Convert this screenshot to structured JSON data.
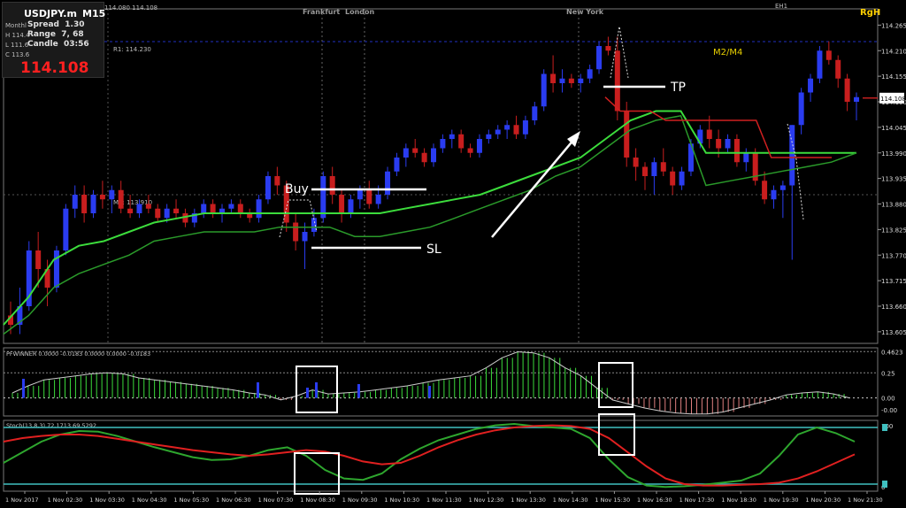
{
  "header": {
    "symbol": "USDJPY.m",
    "timeframe": "M15",
    "top_prices": "114.080 114.108",
    "top_right_mark": "EH1",
    "right_tag": "RgH",
    "info": [
      {
        "side": "Monthl",
        "label": "Spread",
        "value": "1.30"
      },
      {
        "side": "H 114.4",
        "label": "Range",
        "value": "7, 68"
      },
      {
        "side": "L 111.6",
        "label": "Candle",
        "value": "03:56"
      },
      {
        "side": "C 113.6",
        "label": "",
        "value": ""
      }
    ],
    "current_price": "114.108"
  },
  "colors": {
    "bull": "#2a3cf0",
    "bear": "#c81e1e",
    "green": "#3cdc3c",
    "dark_green": "#2a9a2a",
    "red_line": "#d02020",
    "cyan": "#40c0c0"
  },
  "chart_data": [
    {
      "type": "candlestick",
      "title": "USDJPY.m M15",
      "ylim": [
        113.58,
        114.3
      ],
      "y_ticks": [
        "114.265",
        "114.210",
        "114.155",
        "114.100",
        "114.045",
        "113.990",
        "113.935",
        "113.880",
        "113.825",
        "113.770",
        "113.715",
        "113.660",
        "113.605"
      ],
      "y_tick_values": [
        114.265,
        114.21,
        114.155,
        114.1,
        114.045,
        113.99,
        113.935,
        113.88,
        113.825,
        113.77,
        113.715,
        113.66,
        113.605
      ],
      "current_price_label": "114.108",
      "session_labels": [
        "Frankfurt",
        "London",
        "New York"
      ],
      "pivot_labels": [
        "R1: 114.230",
        "M3: 113.910",
        "M2/M4"
      ],
      "annotations": [
        "Buy",
        "SL",
        "TP"
      ],
      "x_labels": [
        "1 Nov 2017",
        "1 Nov 02:30",
        "1 Nov 03:30",
        "1 Nov 04:30",
        "1 Nov 05:30",
        "1 Nov 06:30",
        "1 Nov 07:30",
        "1 Nov 08:30",
        "1 Nov 09:30",
        "1 Nov 10:30",
        "1 Nov 11:30",
        "1 Nov 12:30",
        "1 Nov 13:30",
        "1 Nov 14:30",
        "1 Nov 15:30",
        "1 Nov 16:30",
        "1 Nov 17:30",
        "1 Nov 18:30",
        "1 Nov 19:30",
        "1 Nov 20:30",
        "1 Nov 21:30"
      ],
      "series": [
        {
          "name": "ohlc",
          "values": [
            [
              113.64,
              113.67,
              113.6,
              113.62
            ],
            [
              113.62,
              113.7,
              113.6,
              113.66
            ],
            [
              113.66,
              113.8,
              113.65,
              113.78
            ],
            [
              113.78,
              113.82,
              113.7,
              113.74
            ],
            [
              113.74,
              113.76,
              113.66,
              113.7
            ],
            [
              113.7,
              113.79,
              113.69,
              113.78
            ],
            [
              113.78,
              113.88,
              113.77,
              113.87
            ],
            [
              113.87,
              113.92,
              113.85,
              113.9
            ],
            [
              113.9,
              113.92,
              113.84,
              113.86
            ],
            [
              113.86,
              113.91,
              113.85,
              113.9
            ],
            [
              113.9,
              113.93,
              113.87,
              113.89
            ],
            [
              113.89,
              113.92,
              113.86,
              113.91
            ],
            [
              113.91,
              113.93,
              113.86,
              113.87
            ],
            [
              113.87,
              113.9,
              113.85,
              113.86
            ],
            [
              113.86,
              113.89,
              113.85,
              113.88
            ],
            [
              113.88,
              113.9,
              113.86,
              113.87
            ],
            [
              113.87,
              113.88,
              113.84,
              113.85
            ],
            [
              113.85,
              113.88,
              113.84,
              113.87
            ],
            [
              113.87,
              113.89,
              113.85,
              113.86
            ],
            [
              113.86,
              113.87,
              113.83,
              113.84
            ],
            [
              113.84,
              113.87,
              113.83,
              113.86
            ],
            [
              113.86,
              113.89,
              113.85,
              113.88
            ],
            [
              113.88,
              113.89,
              113.85,
              113.86
            ],
            [
              113.86,
              113.88,
              113.84,
              113.87
            ],
            [
              113.87,
              113.89,
              113.86,
              113.88
            ],
            [
              113.88,
              113.89,
              113.85,
              113.86
            ],
            [
              113.86,
              113.87,
              113.84,
              113.85
            ],
            [
              113.85,
              113.9,
              113.84,
              113.89
            ],
            [
              113.89,
              113.95,
              113.88,
              113.94
            ],
            [
              113.94,
              113.96,
              113.9,
              113.92
            ],
            [
              113.92,
              113.93,
              113.82,
              113.84
            ],
            [
              113.84,
              113.86,
              113.78,
              113.8
            ],
            [
              113.8,
              113.84,
              113.74,
              113.82
            ],
            [
              113.82,
              113.87,
              113.81,
              113.85
            ],
            [
              113.85,
              113.95,
              113.84,
              113.94
            ],
            [
              113.94,
              113.96,
              113.88,
              113.9
            ],
            [
              113.9,
              113.91,
              113.84,
              113.86
            ],
            [
              113.86,
              113.9,
              113.85,
              113.89
            ],
            [
              113.89,
              113.92,
              113.87,
              113.91
            ],
            [
              113.91,
              113.93,
              113.87,
              113.88
            ],
            [
              113.88,
              113.92,
              113.87,
              113.9
            ],
            [
              113.9,
              113.96,
              113.89,
              113.95
            ],
            [
              113.95,
              113.99,
              113.94,
              113.98
            ],
            [
              113.98,
              114.01,
              113.96,
              114.0
            ],
            [
              114.0,
              114.02,
              113.98,
              113.99
            ],
            [
              113.99,
              114.0,
              113.96,
              113.97
            ],
            [
              113.97,
              114.01,
              113.96,
              114.0
            ],
            [
              114.0,
              114.03,
              113.99,
              114.02
            ],
            [
              114.02,
              114.04,
              114.0,
              114.03
            ],
            [
              114.03,
              114.04,
              113.99,
              114.0
            ],
            [
              114.0,
              114.01,
              113.98,
              113.99
            ],
            [
              113.99,
              114.03,
              113.98,
              114.02
            ],
            [
              114.02,
              114.04,
              114.01,
              114.03
            ],
            [
              114.03,
              114.05,
              114.02,
              114.04
            ],
            [
              114.04,
              114.06,
              114.02,
              114.05
            ],
            [
              114.05,
              114.07,
              114.02,
              114.03
            ],
            [
              114.03,
              114.07,
              114.02,
              114.06
            ],
            [
              114.06,
              114.1,
              114.05,
              114.09
            ],
            [
              114.09,
              114.17,
              114.08,
              114.16
            ],
            [
              114.16,
              114.2,
              114.12,
              114.14
            ],
            [
              114.14,
              114.17,
              114.12,
              114.15
            ],
            [
              114.15,
              114.16,
              114.13,
              114.14
            ],
            [
              114.14,
              114.16,
              114.12,
              114.15
            ],
            [
              114.15,
              114.18,
              114.14,
              114.17
            ],
            [
              114.17,
              114.23,
              114.16,
              114.22
            ],
            [
              114.22,
              114.24,
              114.2,
              114.21
            ],
            [
              114.21,
              114.24,
              114.06,
              114.08
            ],
            [
              114.08,
              114.1,
              113.96,
              113.98
            ],
            [
              113.98,
              114.0,
              113.93,
              113.96
            ],
            [
              113.96,
              113.97,
              113.91,
              113.94
            ],
            [
              113.94,
              113.98,
              113.9,
              113.97
            ],
            [
              113.97,
              114.0,
              113.94,
              113.95
            ],
            [
              113.95,
              113.96,
              113.9,
              113.92
            ],
            [
              113.92,
              113.96,
              113.91,
              113.95
            ],
            [
              113.95,
              114.02,
              113.94,
              114.01
            ],
            [
              114.01,
              114.05,
              114.0,
              114.04
            ],
            [
              114.04,
              114.07,
              114.0,
              114.02
            ],
            [
              114.02,
              114.04,
              113.98,
              114.0
            ],
            [
              114.0,
              114.03,
              113.99,
              114.02
            ],
            [
              114.02,
              114.03,
              113.96,
              113.97
            ],
            [
              113.97,
              114.0,
              113.95,
              113.99
            ],
            [
              113.99,
              114.0,
              113.92,
              113.93
            ],
            [
              113.93,
              113.95,
              113.88,
              113.89
            ],
            [
              113.89,
              113.92,
              113.87,
              113.91
            ],
            [
              113.91,
              113.93,
              113.85,
              113.92
            ],
            [
              113.92,
              114.05,
              113.76,
              114.05
            ],
            [
              114.05,
              114.13,
              114.03,
              114.12
            ],
            [
              114.12,
              114.16,
              114.1,
              114.15
            ],
            [
              114.15,
              114.22,
              114.14,
              114.21
            ],
            [
              114.21,
              114.23,
              114.18,
              114.19
            ],
            [
              114.19,
              114.2,
              114.13,
              114.15
            ],
            [
              114.15,
              114.16,
              114.08,
              114.1
            ],
            [
              114.1,
              114.12,
              114.06,
              114.11
            ]
          ]
        },
        {
          "name": "green_band_upper",
          "values": [
            113.62,
            113.68,
            113.76,
            113.79,
            113.8,
            113.82,
            113.84,
            113.85,
            113.86,
            113.86,
            113.86,
            113.86,
            113.86,
            113.86,
            113.86,
            113.86,
            113.87,
            113.88,
            113.89,
            113.9,
            113.92,
            113.94,
            113.96,
            113.98,
            114.02,
            114.06,
            114.08,
            114.08,
            113.99,
            113.99,
            113.99,
            113.99,
            113.99,
            113.99,
            113.99
          ]
        },
        {
          "name": "green_band_lower",
          "values": [
            113.6,
            113.64,
            113.7,
            113.73,
            113.75,
            113.77,
            113.8,
            113.81,
            113.82,
            113.82,
            113.82,
            113.83,
            113.83,
            113.83,
            113.81,
            113.81,
            113.82,
            113.83,
            113.85,
            113.87,
            113.89,
            113.91,
            113.94,
            113.96,
            114.0,
            114.04,
            114.06,
            114.07,
            113.92,
            113.93,
            113.94,
            113.95,
            113.96,
            113.97,
            113.99
          ]
        },
        {
          "name": "red_line",
          "values": [
            114.11,
            114.08,
            114.08,
            114.08,
            114.06,
            114.06,
            114.06,
            114.06,
            114.06,
            114.06,
            114.06,
            113.98,
            113.98,
            113.98,
            113.98,
            113.98
          ]
        }
      ]
    },
    {
      "type": "bar",
      "title": "PFWINNER 0.0000 -0.0183 0.0000 0.0000 -0.0183",
      "y_ticks": [
        "0.4623",
        "0.25",
        "0.00",
        "-0.00"
      ],
      "ylim": [
        -0.18,
        0.5
      ],
      "values": [
        0.05,
        0.12,
        0.18,
        0.2,
        0.22,
        0.24,
        0.25,
        0.24,
        0.2,
        0.18,
        0.16,
        0.14,
        0.12,
        0.1,
        0.08,
        0.05,
        0.03,
        -0.02,
        0.02,
        0.08,
        0.04,
        0.05,
        0.06,
        0.08,
        0.1,
        0.12,
        0.15,
        0.18,
        0.2,
        0.22,
        0.3,
        0.4,
        0.46,
        0.45,
        0.4,
        0.3,
        0.22,
        0.1,
        -0.02,
        -0.06,
        -0.1,
        -0.13,
        -0.15,
        -0.16,
        -0.16,
        -0.14,
        -0.1,
        -0.06,
        -0.02,
        0.03,
        0.05,
        0.06,
        0.04,
        0.0
      ]
    },
    {
      "type": "line",
      "title": "Stoch(13,8,3) 72.1713 69.5292",
      "y_ticks": [
        "100",
        "0"
      ],
      "ylim": [
        0,
        100
      ],
      "levels": [
        90,
        10
      ],
      "series": [
        {
          "values": [
            40,
            55,
            70,
            80,
            85,
            84,
            78,
            70,
            62,
            55,
            48,
            44,
            45,
            50,
            58,
            62,
            50,
            30,
            18,
            16,
            25,
            45,
            60,
            72,
            80,
            88,
            93,
            95,
            92,
            90,
            88,
            75,
            45,
            20,
            8,
            6,
            7,
            9,
            12,
            15,
            25,
            50,
            80,
            90,
            82,
            70
          ]
        },
        {
          "values": [
            70,
            75,
            78,
            80,
            80,
            78,
            74,
            70,
            66,
            62,
            58,
            55,
            52,
            50,
            52,
            55,
            58,
            56,
            50,
            42,
            38,
            40,
            50,
            62,
            72,
            80,
            86,
            90,
            92,
            93,
            92,
            88,
            75,
            55,
            35,
            18,
            10,
            8,
            8,
            9,
            10,
            12,
            18,
            28,
            40,
            52
          ]
        }
      ]
    }
  ]
}
